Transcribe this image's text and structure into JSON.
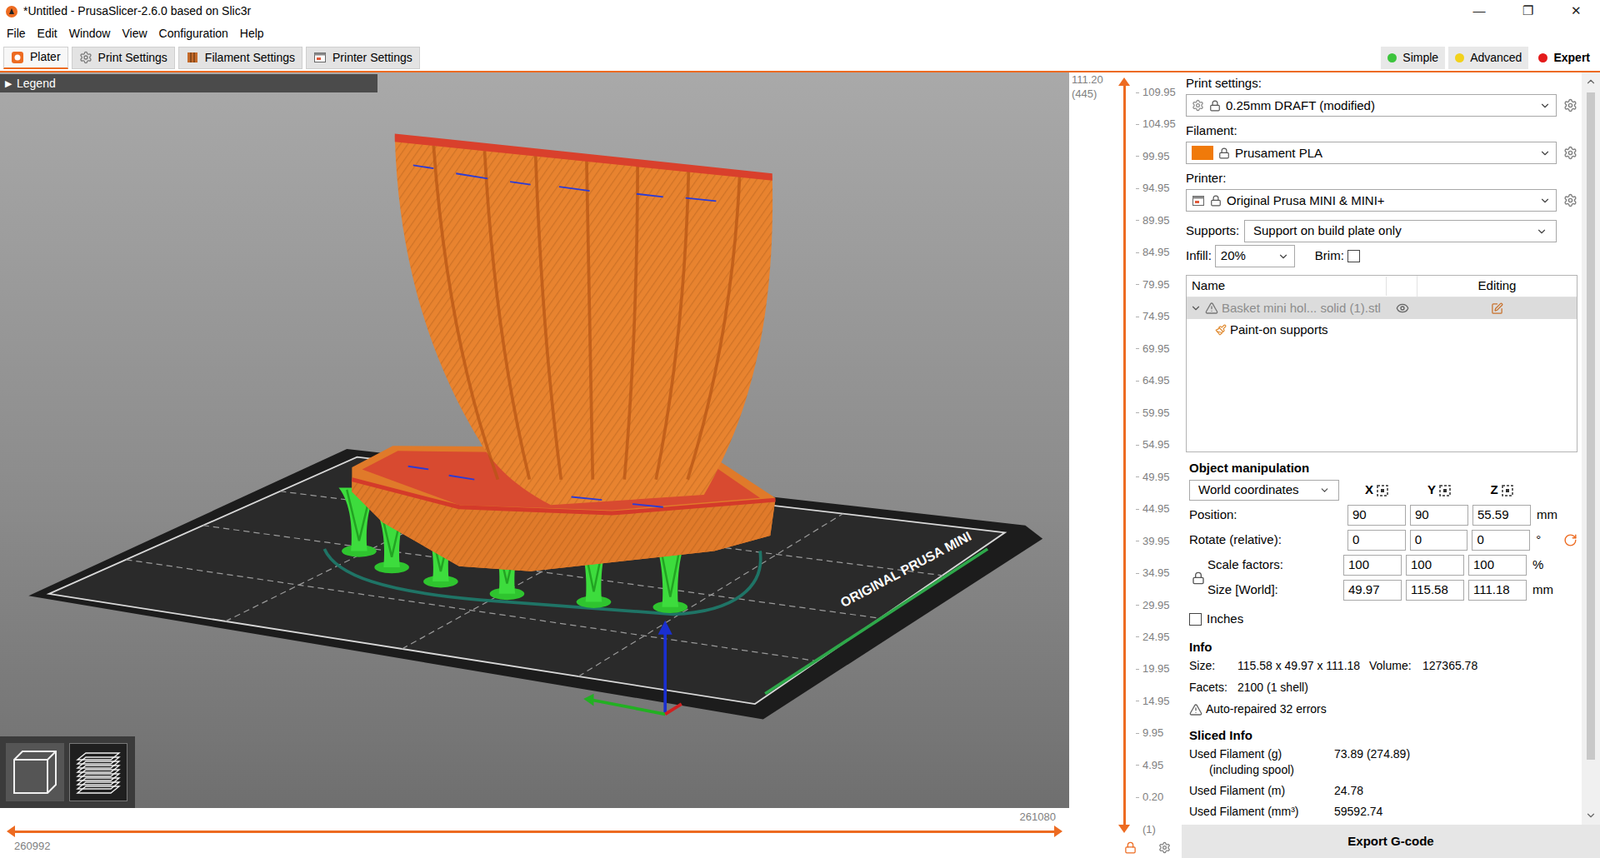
{
  "window": {
    "title": "*Untitled - PrusaSlicer-2.6.0 based on Slic3r",
    "controls": [
      "—",
      "❐",
      "✕"
    ]
  },
  "menu": [
    "File",
    "Edit",
    "Window",
    "View",
    "Configuration",
    "Help"
  ],
  "tabs": [
    {
      "label": "Plater",
      "selected": true
    },
    {
      "label": "Print Settings",
      "selected": false
    },
    {
      "label": "Filament Settings",
      "selected": false
    },
    {
      "label": "Printer Settings",
      "selected": false
    }
  ],
  "modes": [
    {
      "label": "Simple",
      "selected": false,
      "color": "#3cc43c"
    },
    {
      "label": "Advanced",
      "selected": false,
      "color": "#f2d21b"
    },
    {
      "label": "Expert",
      "selected": true,
      "color": "#e41b1b"
    }
  ],
  "legend": {
    "arrow": "▶",
    "label": "Legend"
  },
  "bed_label": "ORIGINAL PRUSA MINI",
  "horizontal_slider": {
    "low": "260992",
    "high": "261080",
    "level": 1
  },
  "vertical_slider": {
    "top": "111.20",
    "top_layer": "(445)",
    "ticks": [
      "109.95",
      "104.95",
      "99.95",
      "94.95",
      "89.95",
      "84.95",
      "79.95",
      "74.95",
      "69.95",
      "64.95",
      "59.95",
      "54.95",
      "49.95",
      "44.95",
      "39.95",
      "34.95",
      "29.95",
      "24.95",
      "19.95",
      "14.95",
      "9.95",
      "4.95",
      "0.20"
    ],
    "bottom_layer": "(1)",
    "level": 1
  },
  "view_toggle": [
    {
      "kind": "3d",
      "selected": false
    },
    {
      "kind": "layers",
      "selected": true
    }
  ],
  "settings": {
    "print": {
      "label": "Print settings:",
      "value": "0.25mm DRAFT (modified)"
    },
    "filament": {
      "label": "Filament:",
      "value": "Prusament PLA",
      "color": "#f07a0a"
    },
    "printer": {
      "label": "Printer:",
      "value": "Original Prusa MINI & MINI+"
    },
    "supports": {
      "label": "Supports:",
      "value": "Support on build plate only"
    },
    "infill": {
      "label": "Infill:",
      "value": "20%"
    },
    "brim": {
      "label": "Brim:",
      "checked": false
    }
  },
  "object_list": {
    "columns": [
      "Name",
      "Editing"
    ],
    "items": [
      {
        "name": "Basket mini hol... solid (1).stl",
        "depth": 0,
        "warning": true,
        "selected": true,
        "expanded": true
      },
      {
        "name": "Paint-on supports",
        "depth": 1,
        "warning": false,
        "selected": false,
        "expanded": false
      }
    ]
  },
  "object_manipulation": {
    "title": "Object manipulation",
    "coordinates": "World coordinates",
    "axes": [
      "X",
      "Y",
      "Z"
    ],
    "rows": [
      {
        "label": "Position:",
        "values": [
          "90",
          "90",
          "55.59"
        ],
        "unit": "mm"
      },
      {
        "label": "Rotate (relative):",
        "values": [
          "0",
          "0",
          "0"
        ],
        "unit": "°"
      },
      {
        "label": "Scale factors:",
        "values": [
          "100",
          "100",
          "100"
        ],
        "unit": "%"
      },
      {
        "label": "Size [World]:",
        "values": [
          "49.97",
          "115.58",
          "111.18"
        ],
        "unit": "mm"
      }
    ],
    "scale_locked": true,
    "inches": {
      "label": "Inches",
      "checked": false
    }
  },
  "info": {
    "title": "Info",
    "size_label": "Size:",
    "size": "115.58 x 49.97 x 111.18",
    "volume_label": "Volume:",
    "volume": "127365.78",
    "facets_label": "Facets:",
    "facets": "2100 (1 shell)",
    "warning": "Auto-repaired 32 errors"
  },
  "sliced_info": {
    "title": "Sliced Info",
    "rows": [
      {
        "label": "Used Filament (g)",
        "sublabel": "(including spool)",
        "value": "73.89 (274.89)"
      },
      {
        "label": "Used Filament (m)",
        "sublabel": "",
        "value": "24.78"
      },
      {
        "label": "Used Filament (mm³)",
        "sublabel": "",
        "value": "59592.74"
      }
    ]
  },
  "export_button": "Export G-code"
}
